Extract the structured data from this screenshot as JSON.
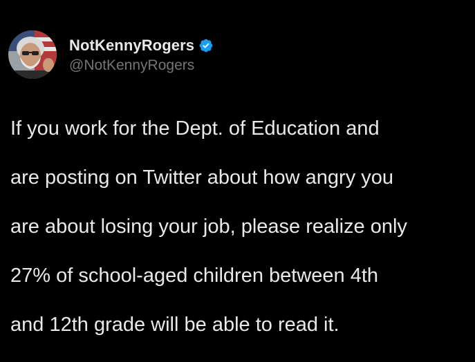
{
  "post": {
    "display_name": "NotKennyRogers",
    "handle": "@NotKennyRogers",
    "verified": true,
    "verified_icon": "verified-badge-icon",
    "avatar_icon": "profile-avatar",
    "text_lines": [
      "If you work for the Dept. of Education and",
      "are posting on Twitter about how angry you",
      "are about losing your job, please realize only",
      "27% of school-aged children between 4th",
      "and 12th grade will be able to read it."
    ]
  },
  "colors": {
    "background": "#000000",
    "text": "#e7e9ea",
    "secondary_text": "#71767b",
    "verified": "#1d9bf0"
  }
}
